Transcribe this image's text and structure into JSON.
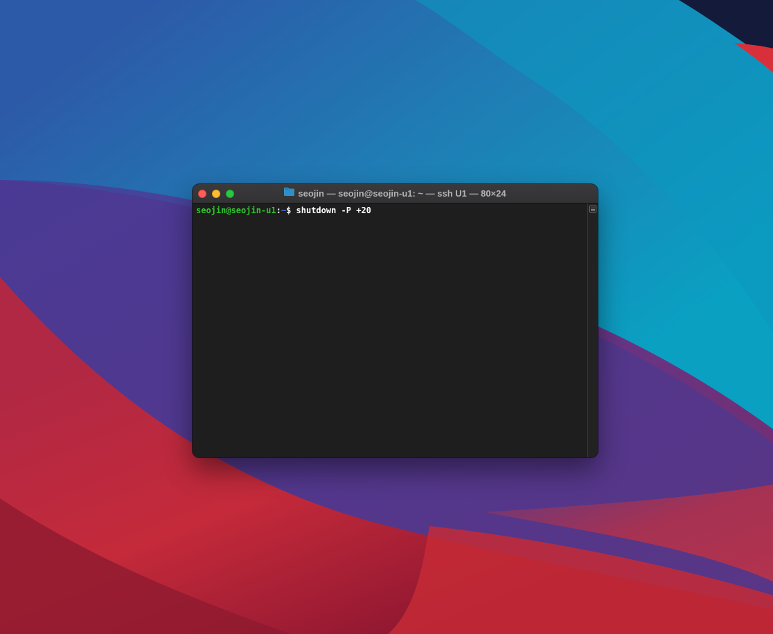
{
  "window": {
    "title": "seojin — seojin@seojin-u1: ~ — ssh U1 — 80×24",
    "folder_icon": "folder-icon",
    "colors": {
      "close": "#fe5f57",
      "minimize": "#febc2e",
      "maximize": "#28c840"
    }
  },
  "terminal": {
    "prompt_user_host": "seojin@seojin-u1",
    "prompt_separator": ":",
    "prompt_path": "~",
    "prompt_symbol": "$",
    "command": "shutdown -P +20",
    "colors": {
      "user_host": "#2ec82e",
      "path": "#5b6dff",
      "background": "#1e1e1e"
    }
  }
}
